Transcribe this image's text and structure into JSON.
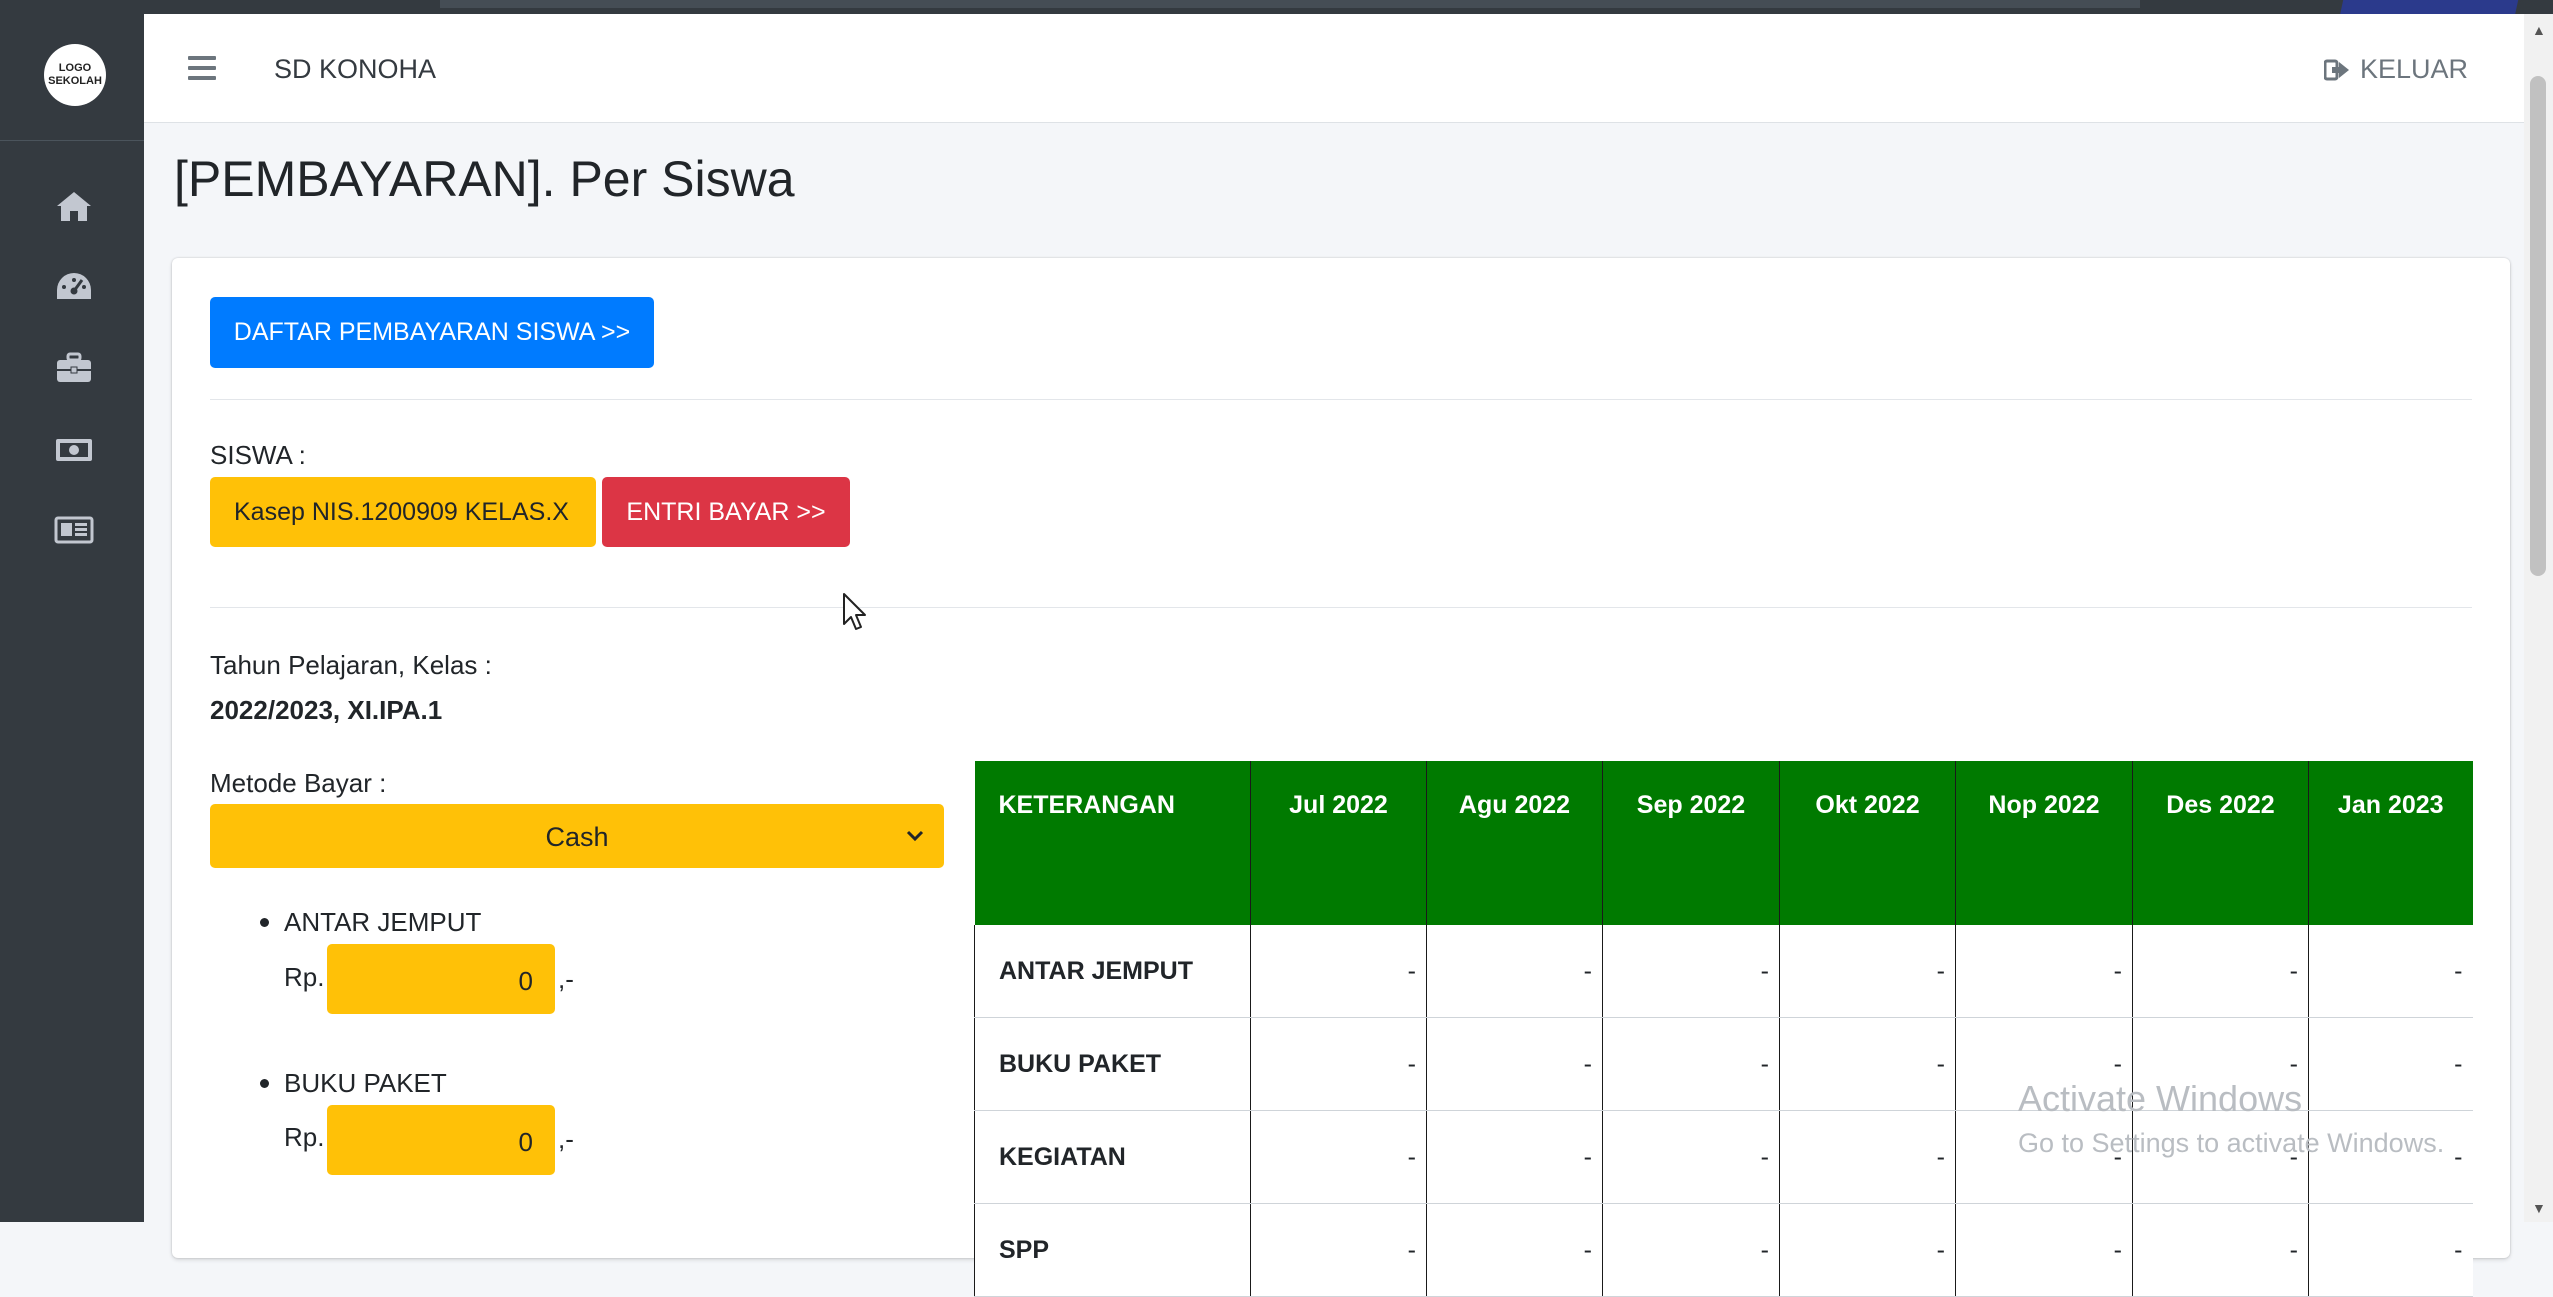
{
  "app": {
    "school_name": "SD KONOHA",
    "logo_text": "LOGO SEKOLAH",
    "logout_label": "KELUAR"
  },
  "sidebar": {
    "icons": [
      "home-icon",
      "dashboard-icon",
      "briefcase-icon",
      "money-icon",
      "newspaper-icon"
    ]
  },
  "page": {
    "title": "[PEMBAYARAN]. Per Siswa",
    "list_button": "DAFTAR PEMBAYARAN SISWA >>",
    "student_label": "SISWA :",
    "student_value": "Kasep NIS.1200909 KELAS.X",
    "entry_button": "ENTRI BAYAR >>",
    "year_class_label": "Tahun Pelajaran, Kelas :",
    "year_class_value": "2022/2023, XI.IPA.1",
    "method_label": "Metode Bayar :",
    "method_value": "Cash"
  },
  "payments": [
    {
      "name": "ANTAR JEMPUT",
      "currency": "Rp.",
      "amount": "0",
      "suffix": ",-"
    },
    {
      "name": "BUKU PAKET",
      "currency": "Rp.",
      "amount": "0",
      "suffix": ",-"
    }
  ],
  "table": {
    "headers": [
      "KETERANGAN",
      "Jul 2022",
      "Agu 2022",
      "Sep 2022",
      "Okt 2022",
      "Nop 2022",
      "Des 2022",
      "Jan 2023"
    ],
    "rows": [
      {
        "label": "ANTAR JEMPUT",
        "cells": [
          "-",
          "-",
          "-",
          "-",
          "-",
          "-",
          "-"
        ]
      },
      {
        "label": "BUKU PAKET",
        "cells": [
          "-",
          "-",
          "-",
          "-",
          "-",
          "-",
          "-"
        ]
      },
      {
        "label": "KEGIATAN",
        "cells": [
          "-",
          "-",
          "-",
          "-",
          "-",
          "-",
          "-"
        ]
      },
      {
        "label": "SPP",
        "cells": [
          "-",
          "-",
          "-",
          "-",
          "-",
          "-",
          "-"
        ]
      }
    ]
  },
  "watermark": {
    "line1": "Activate Windows",
    "line2": "Go to Settings to activate Windows."
  },
  "colors": {
    "sidebar": "#343a40",
    "primary": "#007bff",
    "danger": "#dc3545",
    "warning": "#ffc107",
    "table_header": "#007a00"
  }
}
